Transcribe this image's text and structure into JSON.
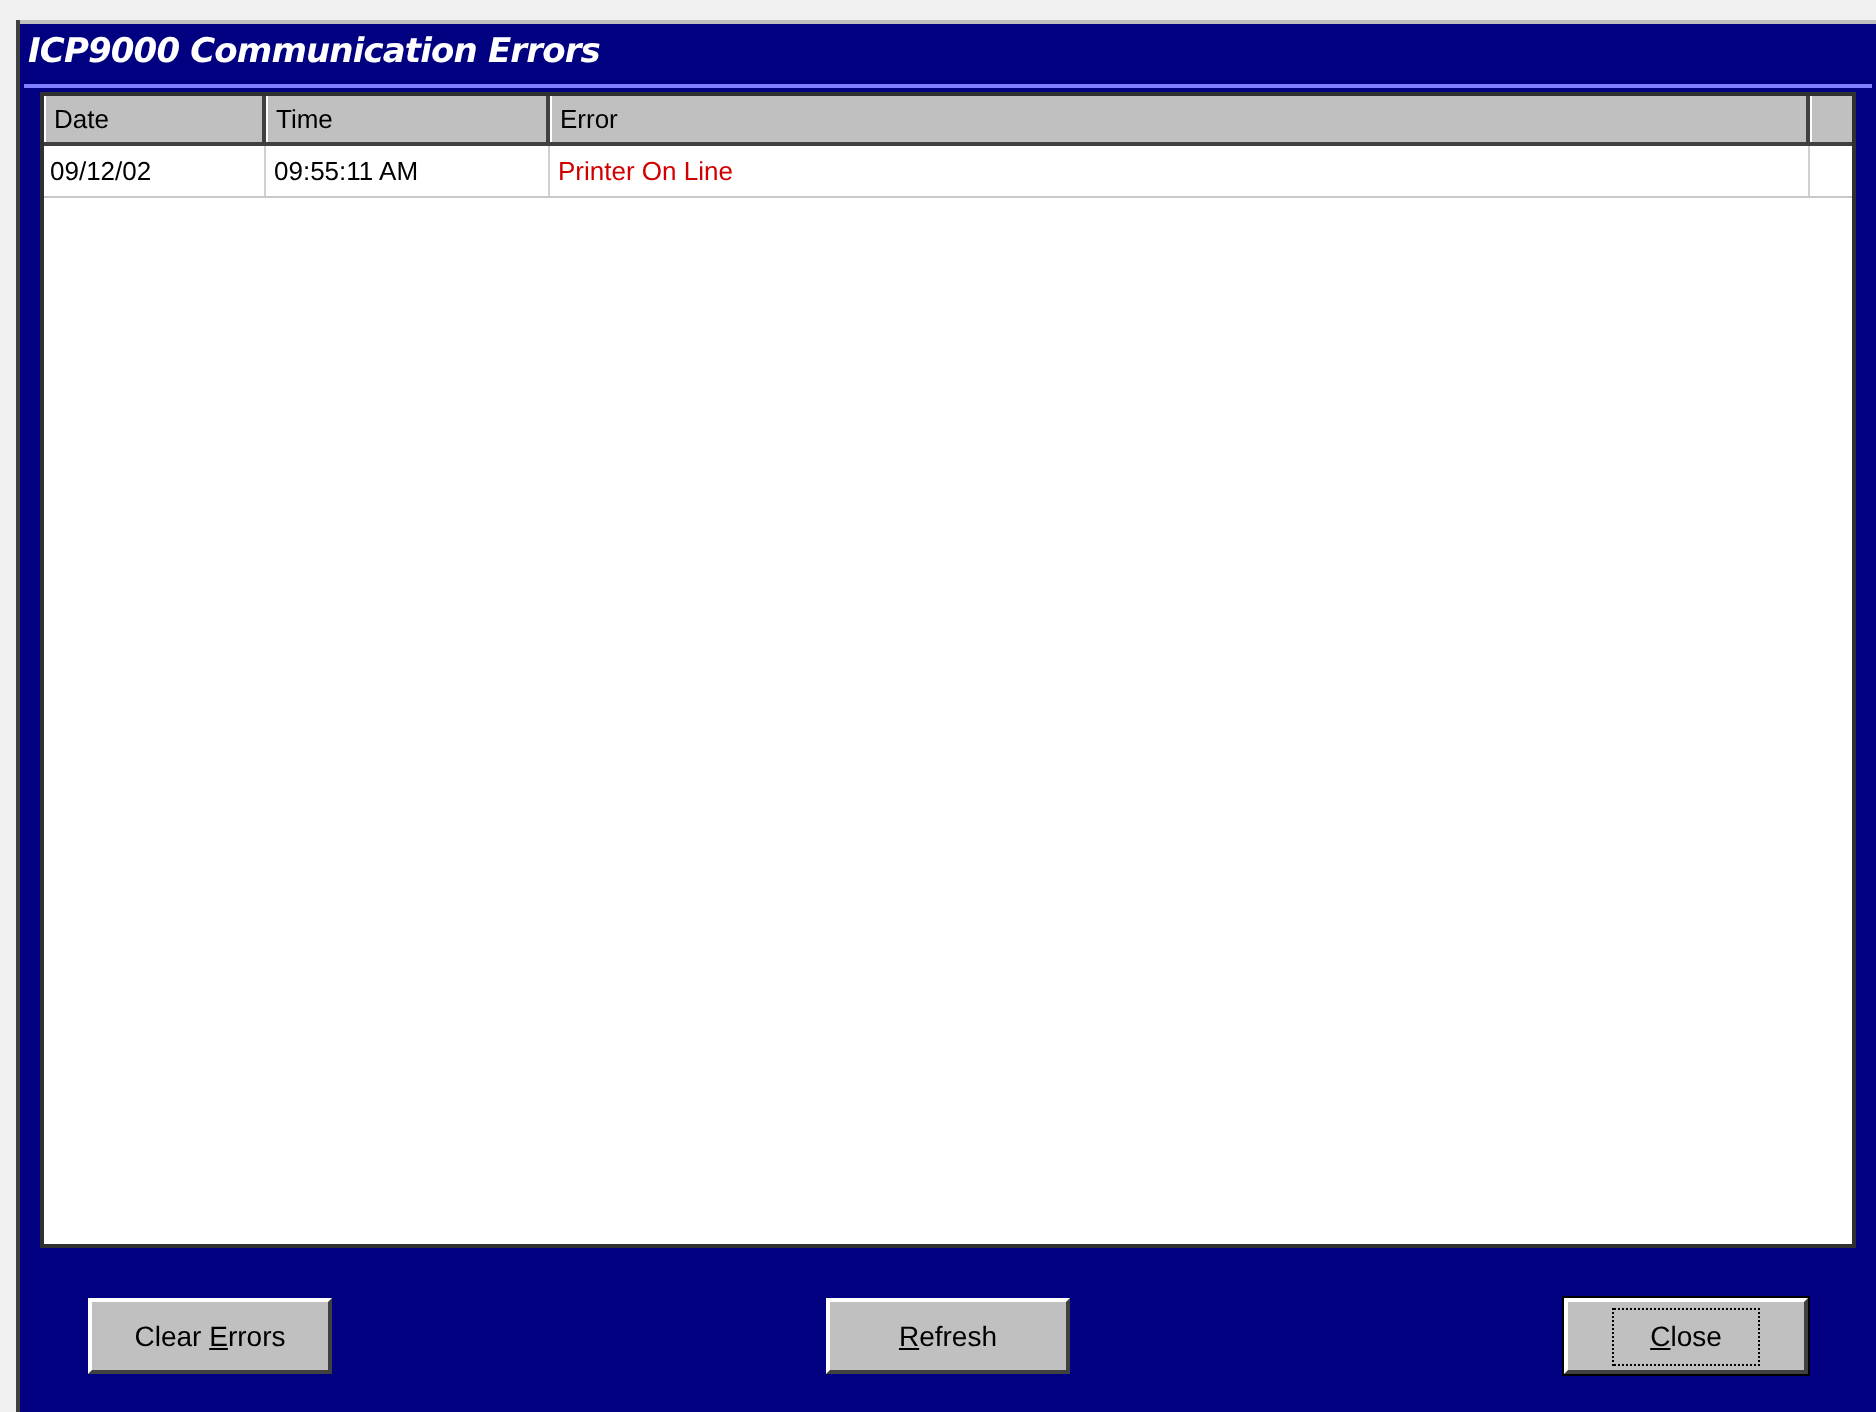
{
  "window": {
    "title": "ICP9000 Communication Errors"
  },
  "table": {
    "columns": [
      "Date",
      "Time",
      "Error"
    ],
    "rows": [
      {
        "date": "09/12/02",
        "time": "09:55:11 AM",
        "error": "Printer On Line"
      }
    ]
  },
  "buttons": [
    {
      "before": "Clear ",
      "key": "E",
      "after": "rrors",
      "focused": false
    },
    {
      "key": "R",
      "after": "efresh",
      "focused": false
    },
    {
      "key": "C",
      "after": "lose",
      "focused": true
    }
  ]
}
